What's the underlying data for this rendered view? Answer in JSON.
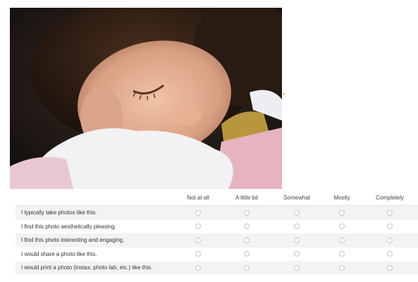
{
  "photo": {
    "icon": "photo-of-sleeping-child"
  },
  "required_indicator": "*",
  "scale": {
    "options": [
      "Not at all",
      "A little bit",
      "Somewhat",
      "Mostly",
      "Completely"
    ]
  },
  "questions": [
    {
      "text": "I typically take photos like this."
    },
    {
      "text": "I find this photo aesthetically pleasing."
    },
    {
      "text": "I find this photo interesting and engaging."
    },
    {
      "text": "I would share a photo like this."
    },
    {
      "text": "I would print a photo (instax, photo lab, etc.) like this."
    }
  ],
  "colors": {
    "required": "#c0392b",
    "row_shade": "#f3f3f3",
    "radio_border": "#c6c6c6"
  }
}
